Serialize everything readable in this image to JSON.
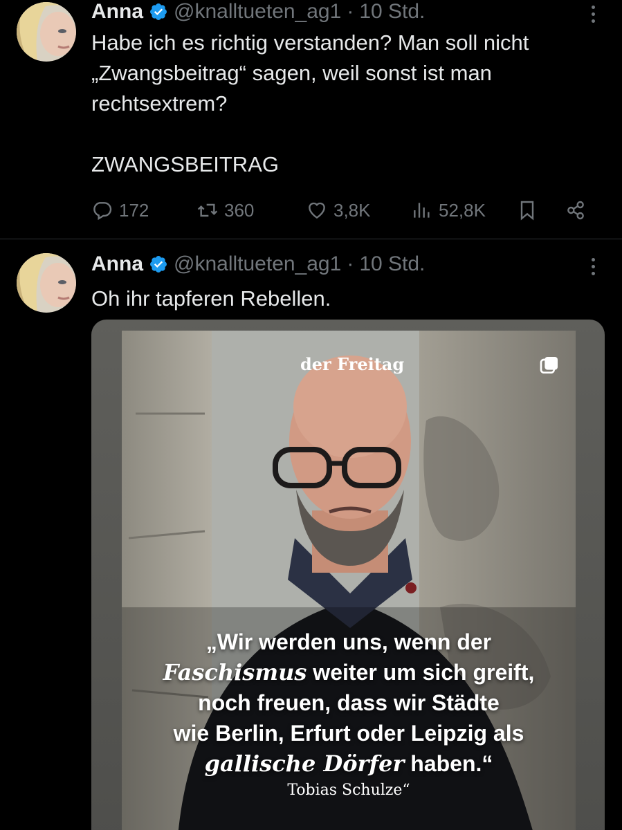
{
  "tweets": [
    {
      "author_name": "Anna",
      "handle": "@knalltueten_ag1",
      "separator": "·",
      "time": "10 Std.",
      "text": "Habe ich es richtig verstanden? Man soll nicht\n„Zwangsbeitrag“ sagen, weil sonst ist man\nrechtsextrem?\n\nZWANGSBEITRAG",
      "actions": {
        "replies": "172",
        "reposts": "360",
        "likes": "3,8K",
        "views": "52,8K"
      },
      "icons": [
        "reply-icon",
        "repost-icon",
        "like-icon",
        "views-icon",
        "bookmark-icon",
        "share-icon"
      ]
    },
    {
      "author_name": "Anna",
      "handle": "@knalltueten_ag1",
      "separator": "·",
      "time": "10 Std.",
      "text": "Oh ihr tapferen Rebellen.",
      "media": {
        "brand": "der Freitag",
        "quote_parts": [
          "„Wir werden uns, wenn der",
          "Faschismus",
          " weiter um sich greift,",
          "noch freuen, dass wir Städte",
          "wie Berlin, Erfurt oder Leipzig als",
          "gallische Dörfer",
          " haben.“"
        ],
        "author": "Tobias Schulze“",
        "icon": "multiple-images-icon"
      }
    }
  ],
  "colors": {
    "background": "#000000",
    "text": "#e7e9ea",
    "muted": "#71767b",
    "verified": "#1d9bf0",
    "divider": "#2f3336"
  }
}
